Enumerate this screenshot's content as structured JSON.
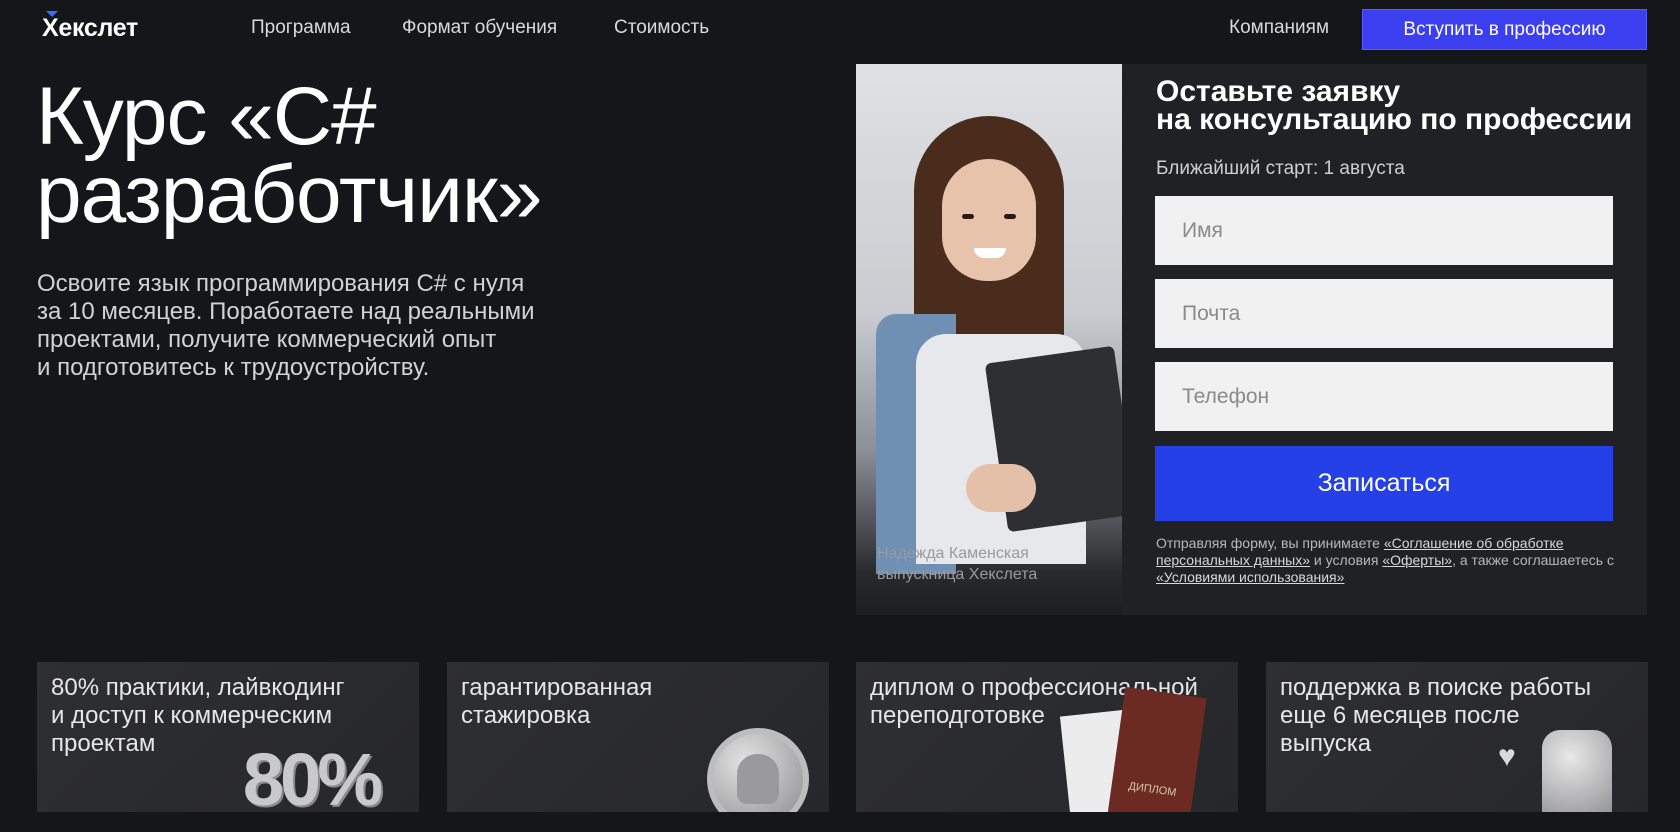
{
  "header": {
    "logo": "Хекслет",
    "nav": [
      "Программа",
      "Формат обучения",
      "Стоимость"
    ],
    "companies_link": "Компаниям",
    "cta": "Вступить в профессию"
  },
  "hero": {
    "title_line1": "Курс «C#",
    "title_line2": "разработчик»",
    "description_lines": [
      "Освоите язык программирования C# с нуля",
      "за 10 месяцев. Поработаете над реальными",
      "проектами, получите коммерческий опыт",
      "и подготовитесь к трудоустройству."
    ]
  },
  "photo": {
    "caption_name": "Надежда Каменская",
    "caption_role": "выпускница Хекслета"
  },
  "form": {
    "title_line1": "Оставьте заявку",
    "title_line2": "на консультацию по профессии",
    "start_label": "Ближайший старт: 1 августа",
    "name_placeholder": "Имя",
    "email_placeholder": "Почта",
    "phone_placeholder": "Телефон",
    "submit": "Записаться",
    "legal_prefix": "Отправляя форму, вы принимаете ",
    "legal_link1": "«Соглашение об обработке персональных данных»",
    "legal_mid": " и условия ",
    "legal_link2": "«Оферты»",
    "legal_mid2": ", а также соглашаетесь с ",
    "legal_link3": "«Условиями использования»"
  },
  "features": [
    {
      "line1": "80% практики, лайвкодинг",
      "line2": "и доступ к коммерческим",
      "line3": "проектам",
      "visual_text": "80%"
    },
    {
      "line1": "гарантированная",
      "line2": "стажировка",
      "line3": ""
    },
    {
      "line1": "диплом о профессиональной",
      "line2": "переподготовке",
      "line3": "",
      "visual_text": "ДИПЛОМ"
    },
    {
      "line1": "поддержка в поиске работы",
      "line2": "еще 6 месяцев после",
      "line3": "выпуска"
    }
  ],
  "colors": {
    "background": "#151619",
    "accent": "#2540e6",
    "cta": "#3b3ff0",
    "panel": "#202124"
  },
  "icons": [
    "logo-mark-icon",
    "github-octocat-icon",
    "heart-icon",
    "thumbs-up-icon"
  ]
}
